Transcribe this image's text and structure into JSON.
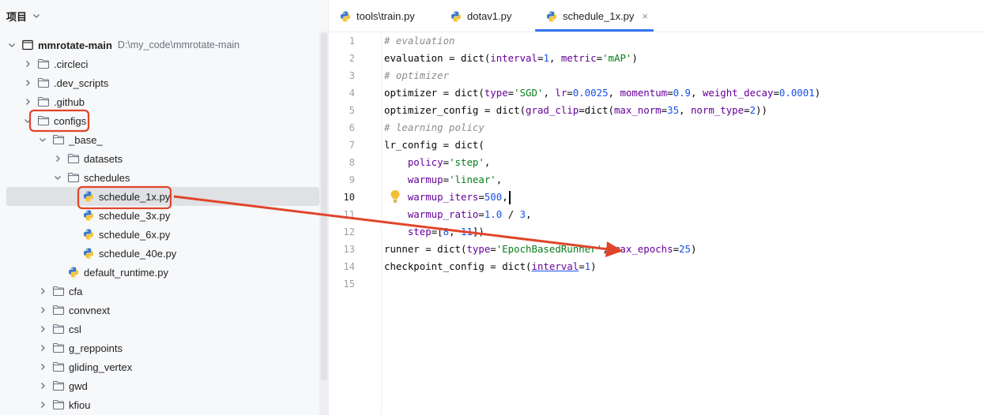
{
  "panel": {
    "title": "项目"
  },
  "tree": [
    {
      "label": "mmrotate-main",
      "path": "D:\\my_code\\mmrotate-main"
    },
    {
      "label": ".circleci"
    },
    {
      "label": ".dev_scripts"
    },
    {
      "label": ".github"
    },
    {
      "label": "configs"
    },
    {
      "label": "_base_"
    },
    {
      "label": "datasets"
    },
    {
      "label": "schedules"
    },
    {
      "label": "schedule_1x.py"
    },
    {
      "label": "schedule_3x.py"
    },
    {
      "label": "schedule_6x.py"
    },
    {
      "label": "schedule_40e.py"
    },
    {
      "label": "default_runtime.py"
    },
    {
      "label": "cfa"
    },
    {
      "label": "convnext"
    },
    {
      "label": "csl"
    },
    {
      "label": "g_reppoints"
    },
    {
      "label": "gliding_vertex"
    },
    {
      "label": "gwd"
    },
    {
      "label": "kfiou"
    }
  ],
  "tabs": [
    {
      "label": "tools\\train.py"
    },
    {
      "label": "dotav1.py"
    },
    {
      "label": "schedule_1x.py",
      "close": "×"
    }
  ],
  "line_numbers": [
    "1",
    "2",
    "3",
    "4",
    "5",
    "6",
    "7",
    "8",
    "9",
    "10",
    "11",
    "12",
    "13",
    "14",
    "15"
  ],
  "code": [
    "# evaluation",
    "evaluation = dict(interval=1, metric='mAP')",
    "# optimizer",
    "optimizer = dict(type='SGD', lr=0.0025, momentum=0.9, weight_decay=0.0001)",
    "optimizer_config = dict(grad_clip=dict(max_norm=35, norm_type=2))",
    "# learning policy",
    "lr_config = dict(",
    "    policy='step',",
    "    warmup='linear',",
    "    warmup_iters=500,",
    "    warmup_ratio=1.0 / 3,",
    "    step=[8, 11])",
    "runner = dict(type='EpochBasedRunner', max_epochs=25)",
    "checkpoint_config = dict(interval=1)",
    ""
  ],
  "colors": {
    "accent": "#3574f0",
    "annotation": "#e0452b",
    "selected_row": "#dfe1e5"
  }
}
